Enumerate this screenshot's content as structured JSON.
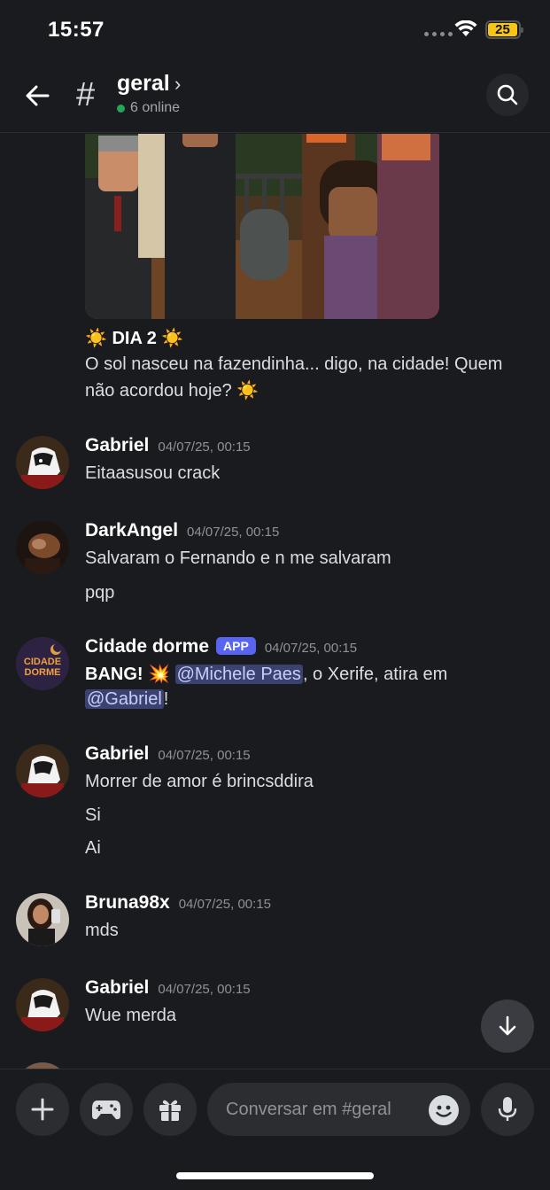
{
  "status_bar": {
    "time": "15:57",
    "battery": "25"
  },
  "header": {
    "hash": "#",
    "channel": "geral",
    "online": "6 online"
  },
  "intro_post": {
    "title": "☀️ DIA 2 ☀️",
    "line1": "O sol nasceu na fazendinha... digo, na cidade! Quem",
    "line2": "não acordou hoje? ☀️"
  },
  "messages": [
    {
      "user": "Gabriel",
      "time": "04/07/25, 00:15",
      "lines": [
        "Eitaasusou crack"
      ]
    },
    {
      "user": "DarkAngel",
      "time": "04/07/25, 00:15",
      "lines": [
        "Salvaram o Fernando e n me salvaram",
        "pqp"
      ]
    },
    {
      "user": "Cidade dorme",
      "badge": "APP",
      "time": "04/07/25, 00:15",
      "bang": "BANG! 💥 ",
      "mention1": "@Michele Paes",
      "mid": ", o Xerife, atira em",
      "mention2": "@Gabriel",
      "end": "!",
      "avatar_text1": "CIDADE",
      "avatar_text2": "DORME"
    },
    {
      "user": "Gabriel",
      "time": "04/07/25, 00:15",
      "lines": [
        "Morrer de amor é brincsddira",
        "Si",
        "Ai"
      ]
    },
    {
      "user": "Bruna98x",
      "time": "04/07/25, 00:15",
      "lines": [
        "mds"
      ]
    },
    {
      "user": "Gabriel",
      "time": "04/07/25, 00:15",
      "lines": [
        "Wue merda"
      ]
    }
  ],
  "composer": {
    "placeholder": "Conversar em #geral"
  },
  "colors": {
    "background": "#1a1b1e",
    "accent": "#5865f2",
    "online": "#23a55a",
    "mention_bg": "#3c4270"
  }
}
